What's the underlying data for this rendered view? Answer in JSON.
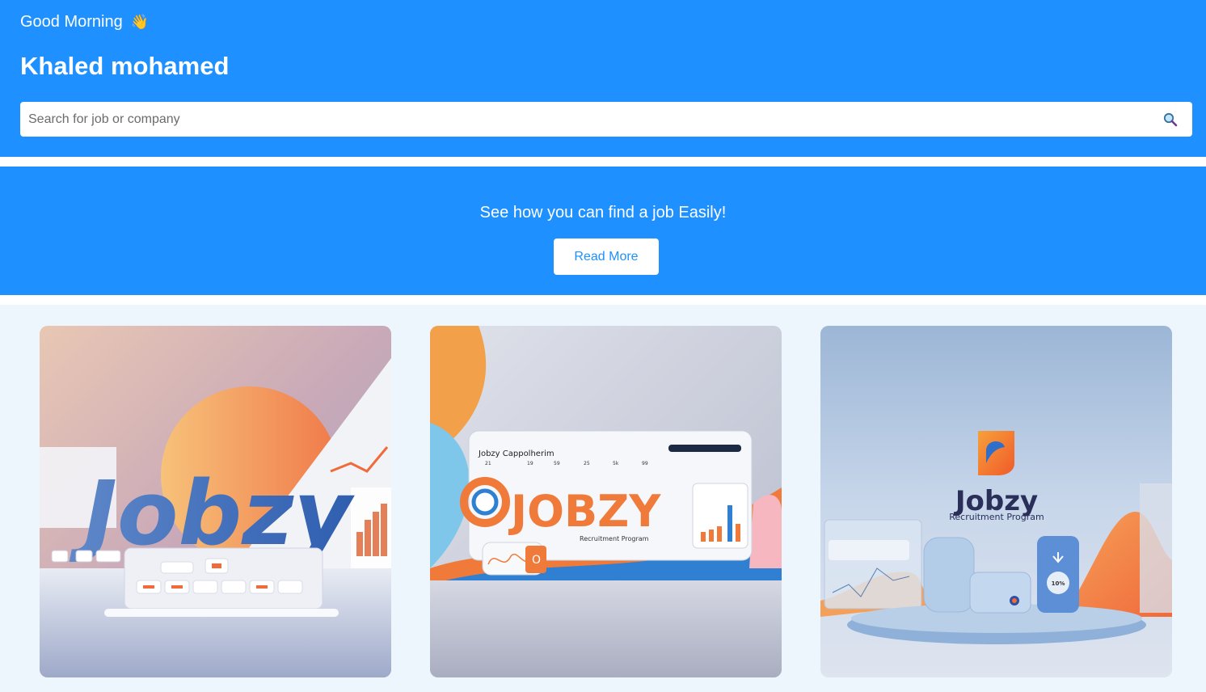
{
  "header": {
    "greeting": "Good Morning",
    "wave_emoji": "👋",
    "username": "Khaled mohamed",
    "search_placeholder": "Search for job or company"
  },
  "banner": {
    "text": "See how you can find a job Easily!",
    "button_label": "Read More"
  },
  "cards": [
    {
      "brand": "Jobzy"
    },
    {
      "brand": "JOBZY",
      "subtitle": "Recruitment Program",
      "panel_title": "Jobzy Cappolherim"
    },
    {
      "brand": "Jobzy",
      "subtitle": "Recruitment Program",
      "badge": "10%"
    }
  ],
  "colors": {
    "primary": "#1e90ff",
    "background": "#eef6fd",
    "accent": "#ff7a3d"
  }
}
